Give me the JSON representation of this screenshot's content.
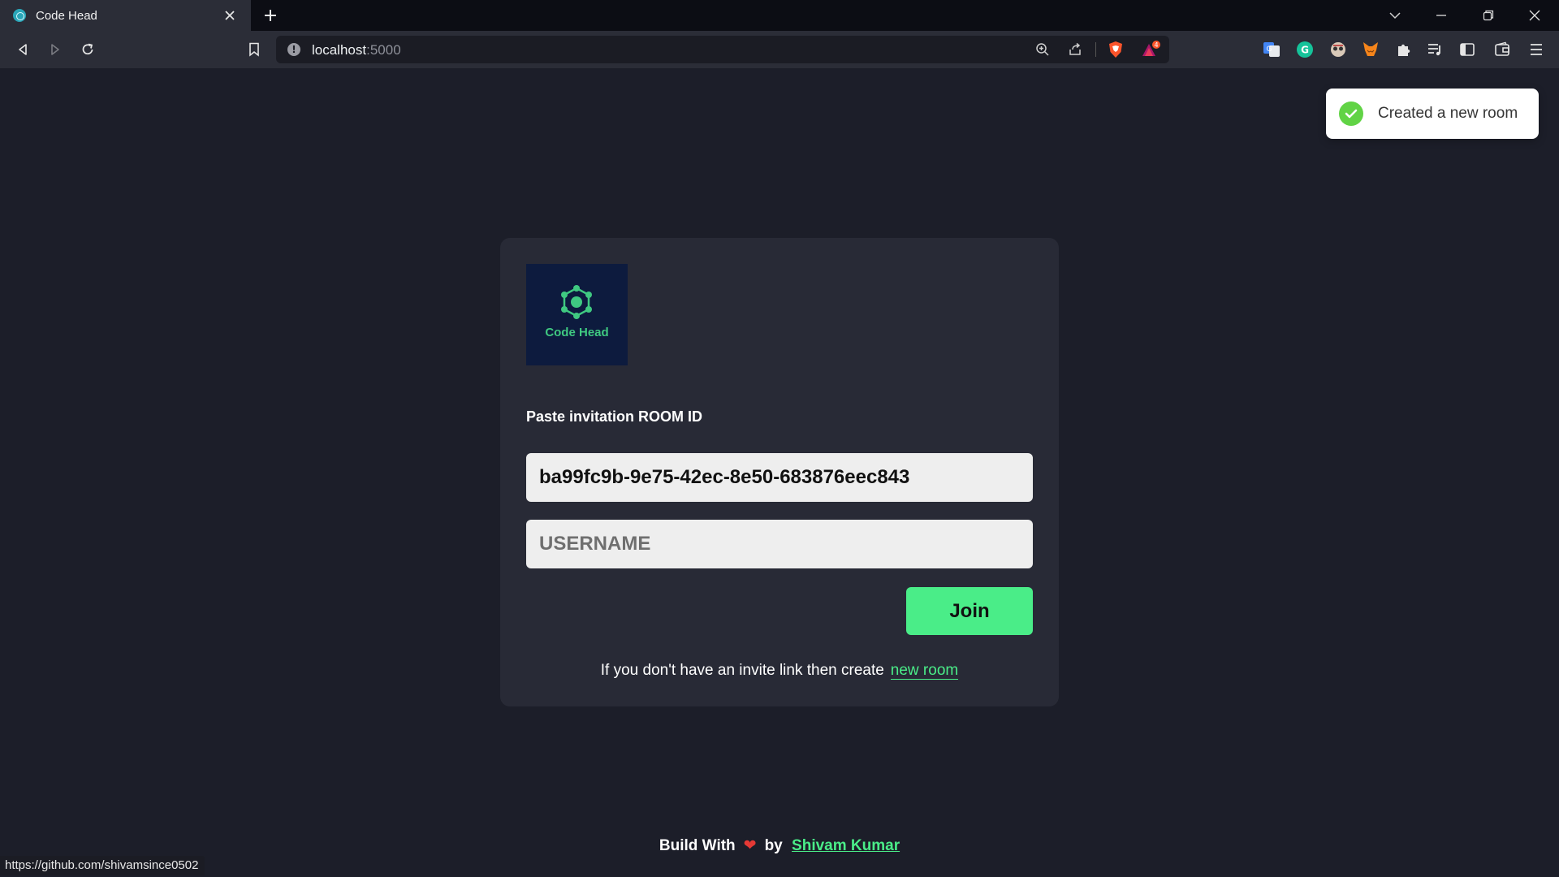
{
  "browser": {
    "tab_title": "Code Head",
    "url_host": "localhost",
    "url_port": ":5000",
    "shields_badge": "4",
    "status_url": "https://github.com/shivamsince0502"
  },
  "toast": {
    "message": "Created a new room"
  },
  "logo": {
    "text": "Code Head"
  },
  "form": {
    "label": "Paste invitation ROOM ID",
    "room_id_value": "ba99fc9b-9e75-42ec-8e50-683876eec843",
    "username_placeholder": "USERNAME",
    "join_label": "Join",
    "create_text": "If you don't have an invite link then create",
    "create_link": "new room"
  },
  "footer": {
    "build_with": "Build With",
    "heart": "❤",
    "by": "by",
    "author": "Shivam Kumar"
  },
  "colors": {
    "accent": "#4aed88",
    "background": "#1c1e29",
    "card": "#282a36",
    "toast_success": "#61d345"
  }
}
